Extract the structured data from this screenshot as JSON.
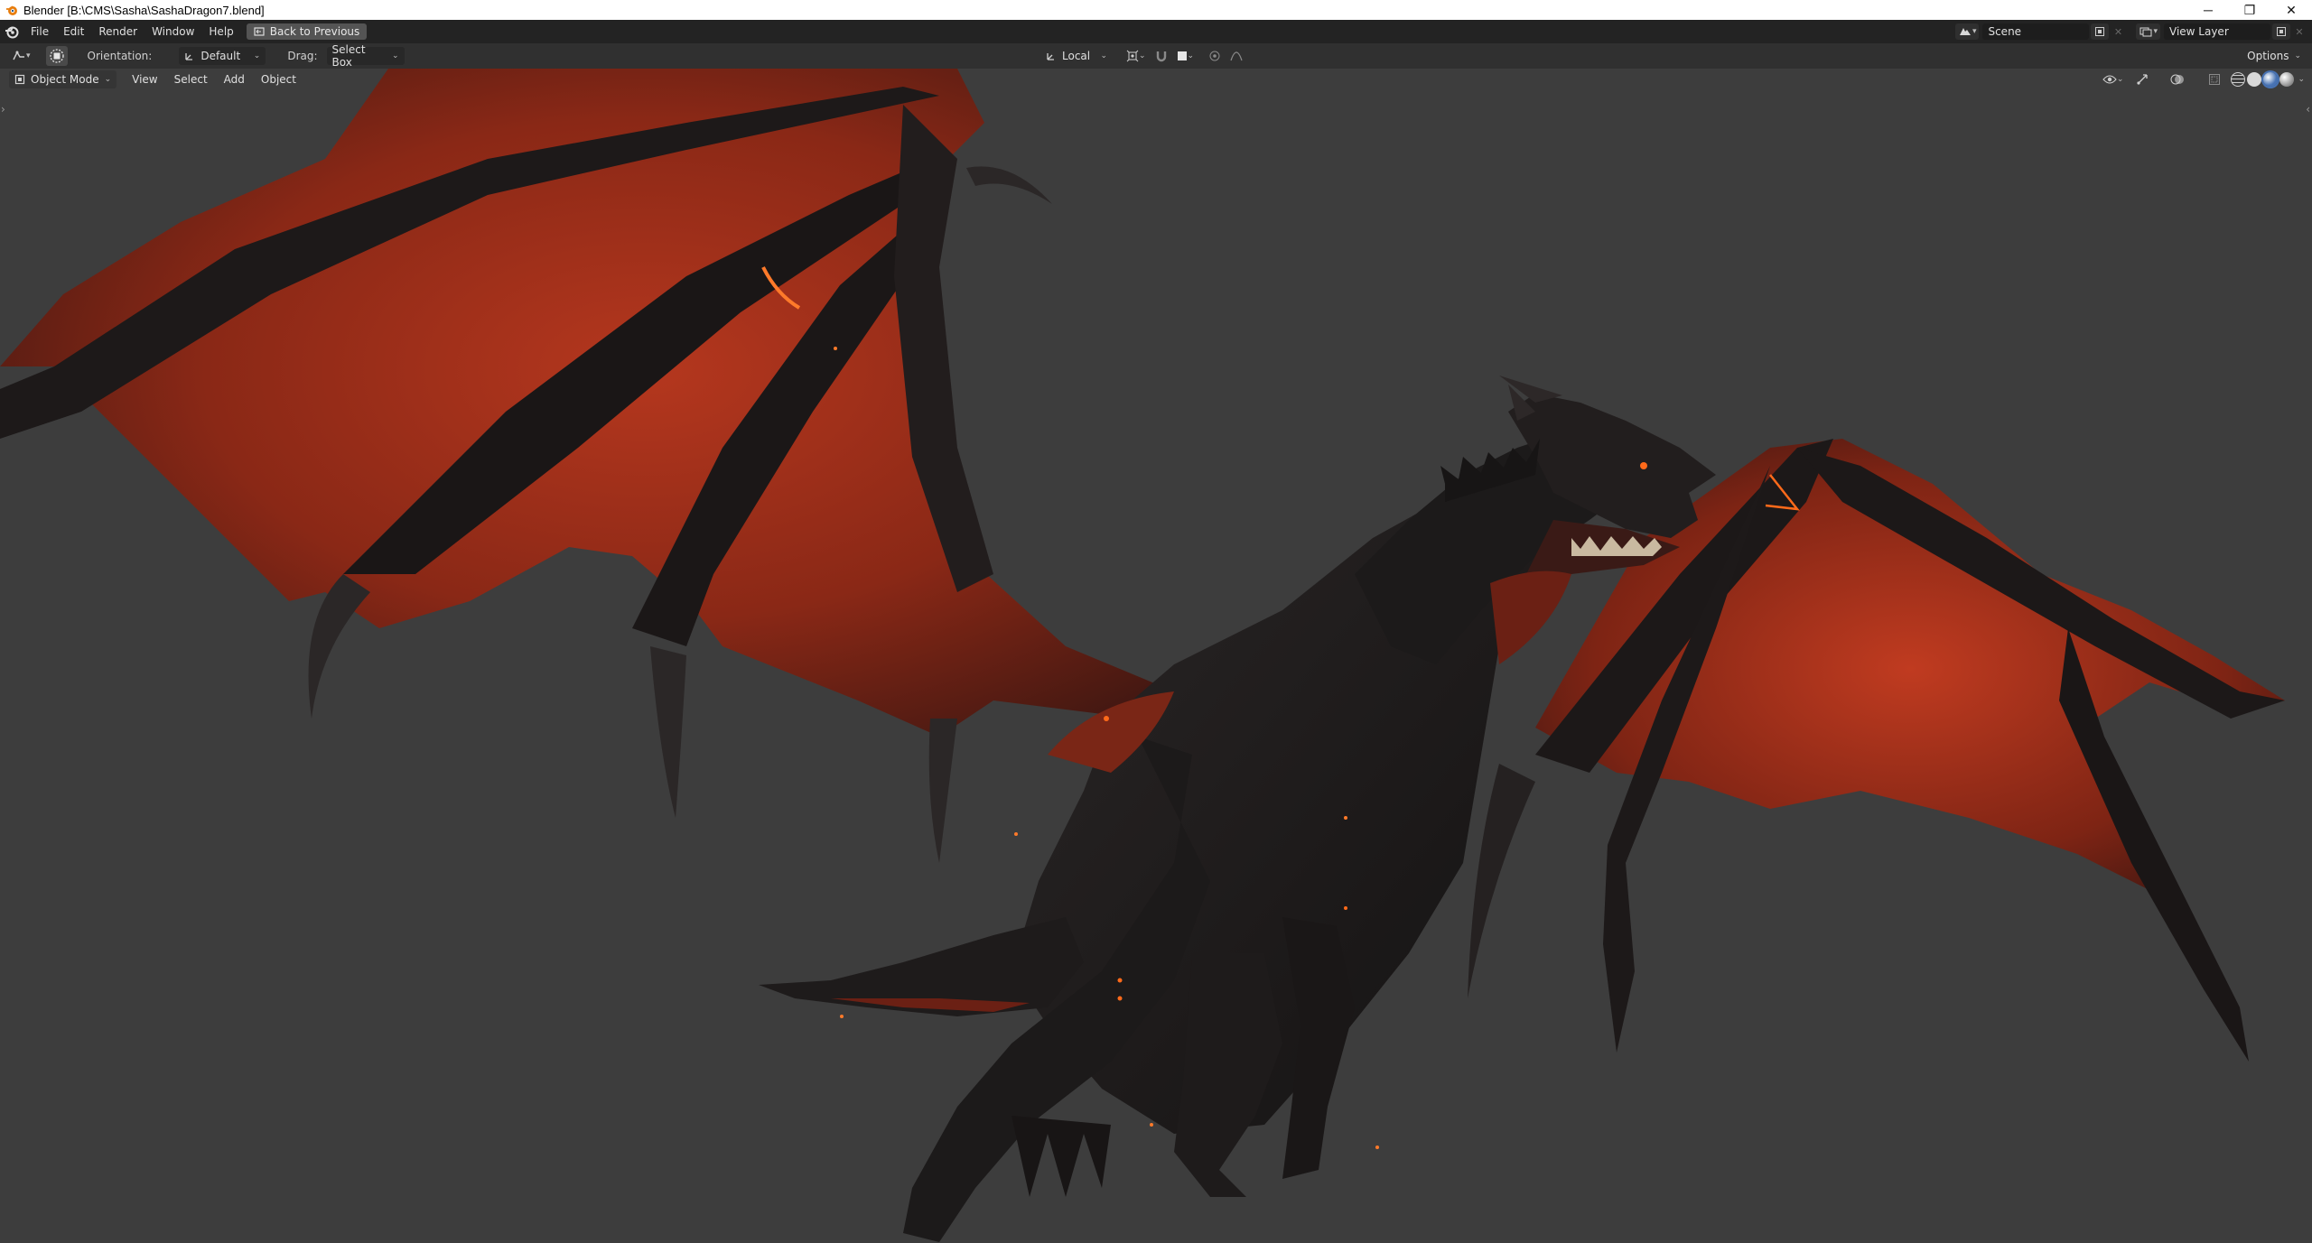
{
  "window": {
    "title": "Blender [B:\\CMS\\Sasha\\SashaDragon7.blend]",
    "controls": {
      "minimize": "─",
      "maximize": "❐",
      "close": "✕"
    }
  },
  "topbar": {
    "menus": [
      "File",
      "Edit",
      "Render",
      "Window",
      "Help"
    ],
    "back_button": "Back to Previous",
    "scene": "Scene",
    "view_layer": "View Layer"
  },
  "tool_header": {
    "orientation_label": "Orientation:",
    "orientation_value": "Default",
    "drag_label": "Drag:",
    "drag_value": "Select Box",
    "pivot_value": "Local",
    "options_label": "Options"
  },
  "viewport_header": {
    "mode": "Object Mode",
    "menus": [
      "View",
      "Select",
      "Add",
      "Object"
    ]
  },
  "colors": {
    "viewport_bg": "#3d3d3d",
    "header_bg": "#303030",
    "topbar_bg": "#232323",
    "accent": "#4772b3",
    "wing_membrane": "#8b2a1a",
    "dragon_body": "#1c1a1a",
    "ember": "#ff6a1a"
  },
  "icons": {
    "app": "blender-logo-icon",
    "editor_type": "3d-viewport-icon",
    "select_tool": "select-circle-icon",
    "orientation": "transform-orientation-icon",
    "snap": "magnet-icon",
    "proportional": "proportional-edit-icon",
    "visibility": "eye-icon",
    "gizmo": "gizmo-icon",
    "overlay": "overlay-icon",
    "xray": "xray-icon"
  }
}
